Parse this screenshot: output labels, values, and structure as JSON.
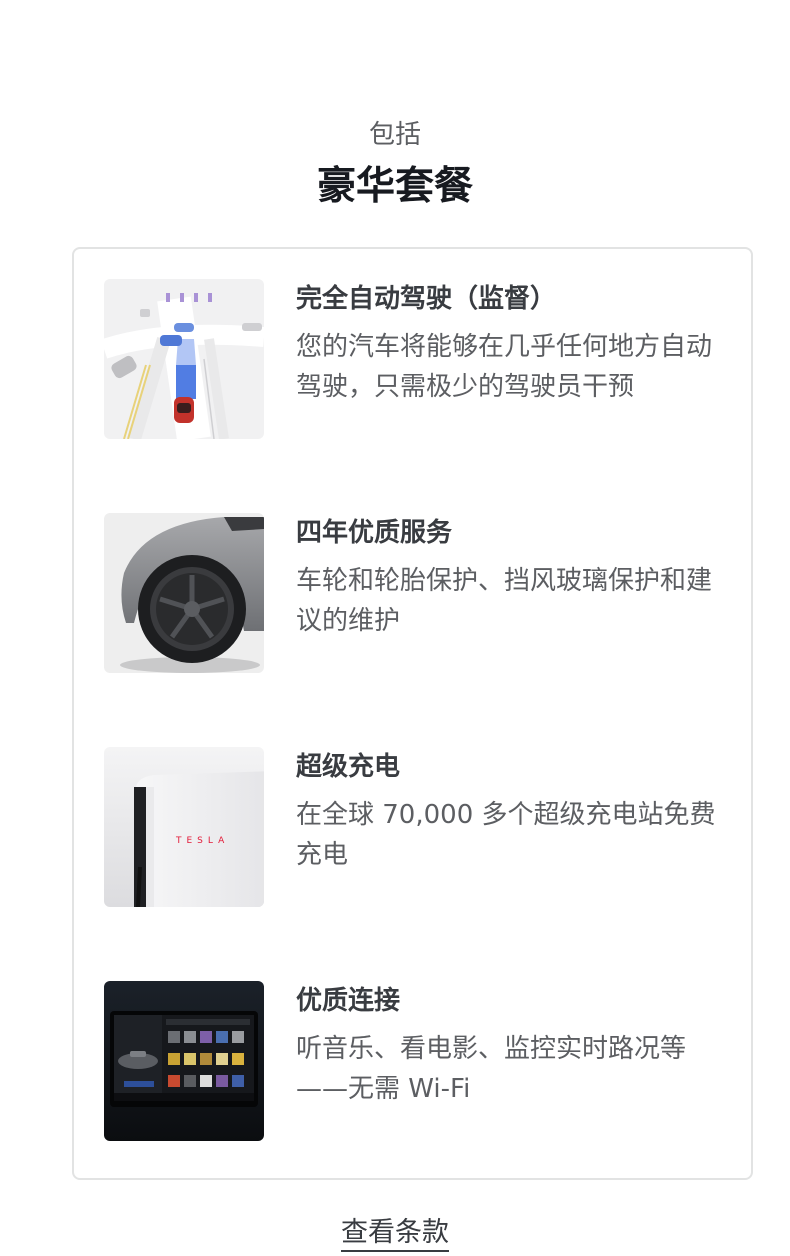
{
  "header": {
    "eyebrow": "包括",
    "title": "豪华套餐"
  },
  "features": [
    {
      "title": "完全自动驾驶（监督）",
      "description": "您的汽车将能够在几乎任何地方自动驾驶，只需极少的驾驶员干预",
      "image": "autopilot-map-visualization"
    },
    {
      "title": "四年优质服务",
      "description": "车轮和轮胎保护、挡风玻璃保护和建议的维护",
      "image": "car-wheel-photo"
    },
    {
      "title": "超级充电",
      "description": "在全球 70,000 多个超级充电站免费充电",
      "image": "supercharger-photo",
      "image_text": "TESLA"
    },
    {
      "title": "优质连接",
      "description": "听音乐、看电影、监控实时路况等——无需 Wi-Fi",
      "image": "touchscreen-photo"
    }
  ],
  "footer": {
    "terms_link": "查看条款"
  },
  "colors": {
    "heading": "#171a20",
    "body_text": "#5c5e62",
    "feature_title": "#393c41",
    "card_border": "#e2e3e3",
    "tesla_red": "#e31937"
  }
}
